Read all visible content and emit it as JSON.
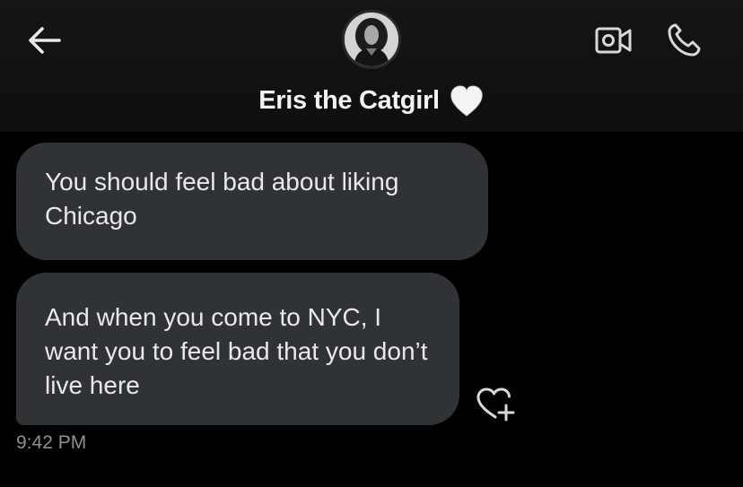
{
  "header": {
    "contact_name": "Eris the Catgirl",
    "name_emoji": "white-heart",
    "back_icon": "arrow-left-icon",
    "video_icon": "video-camera-icon",
    "phone_icon": "phone-icon"
  },
  "messages": [
    {
      "text": "You should feel bad about liking Chicago",
      "direction": "incoming"
    },
    {
      "text": "And when you come to NYC, I want you to feel bad that you don’t live here",
      "direction": "incoming"
    }
  ],
  "reaction": {
    "icon": "heart-plus-icon"
  },
  "timestamp": "9:42 PM",
  "colors": {
    "background": "#000000",
    "header_background": "#141414",
    "bubble": "#2f3336",
    "text": "#e7e9ea",
    "secondary_text": "#8b9196",
    "icon": "#d6d9db"
  }
}
